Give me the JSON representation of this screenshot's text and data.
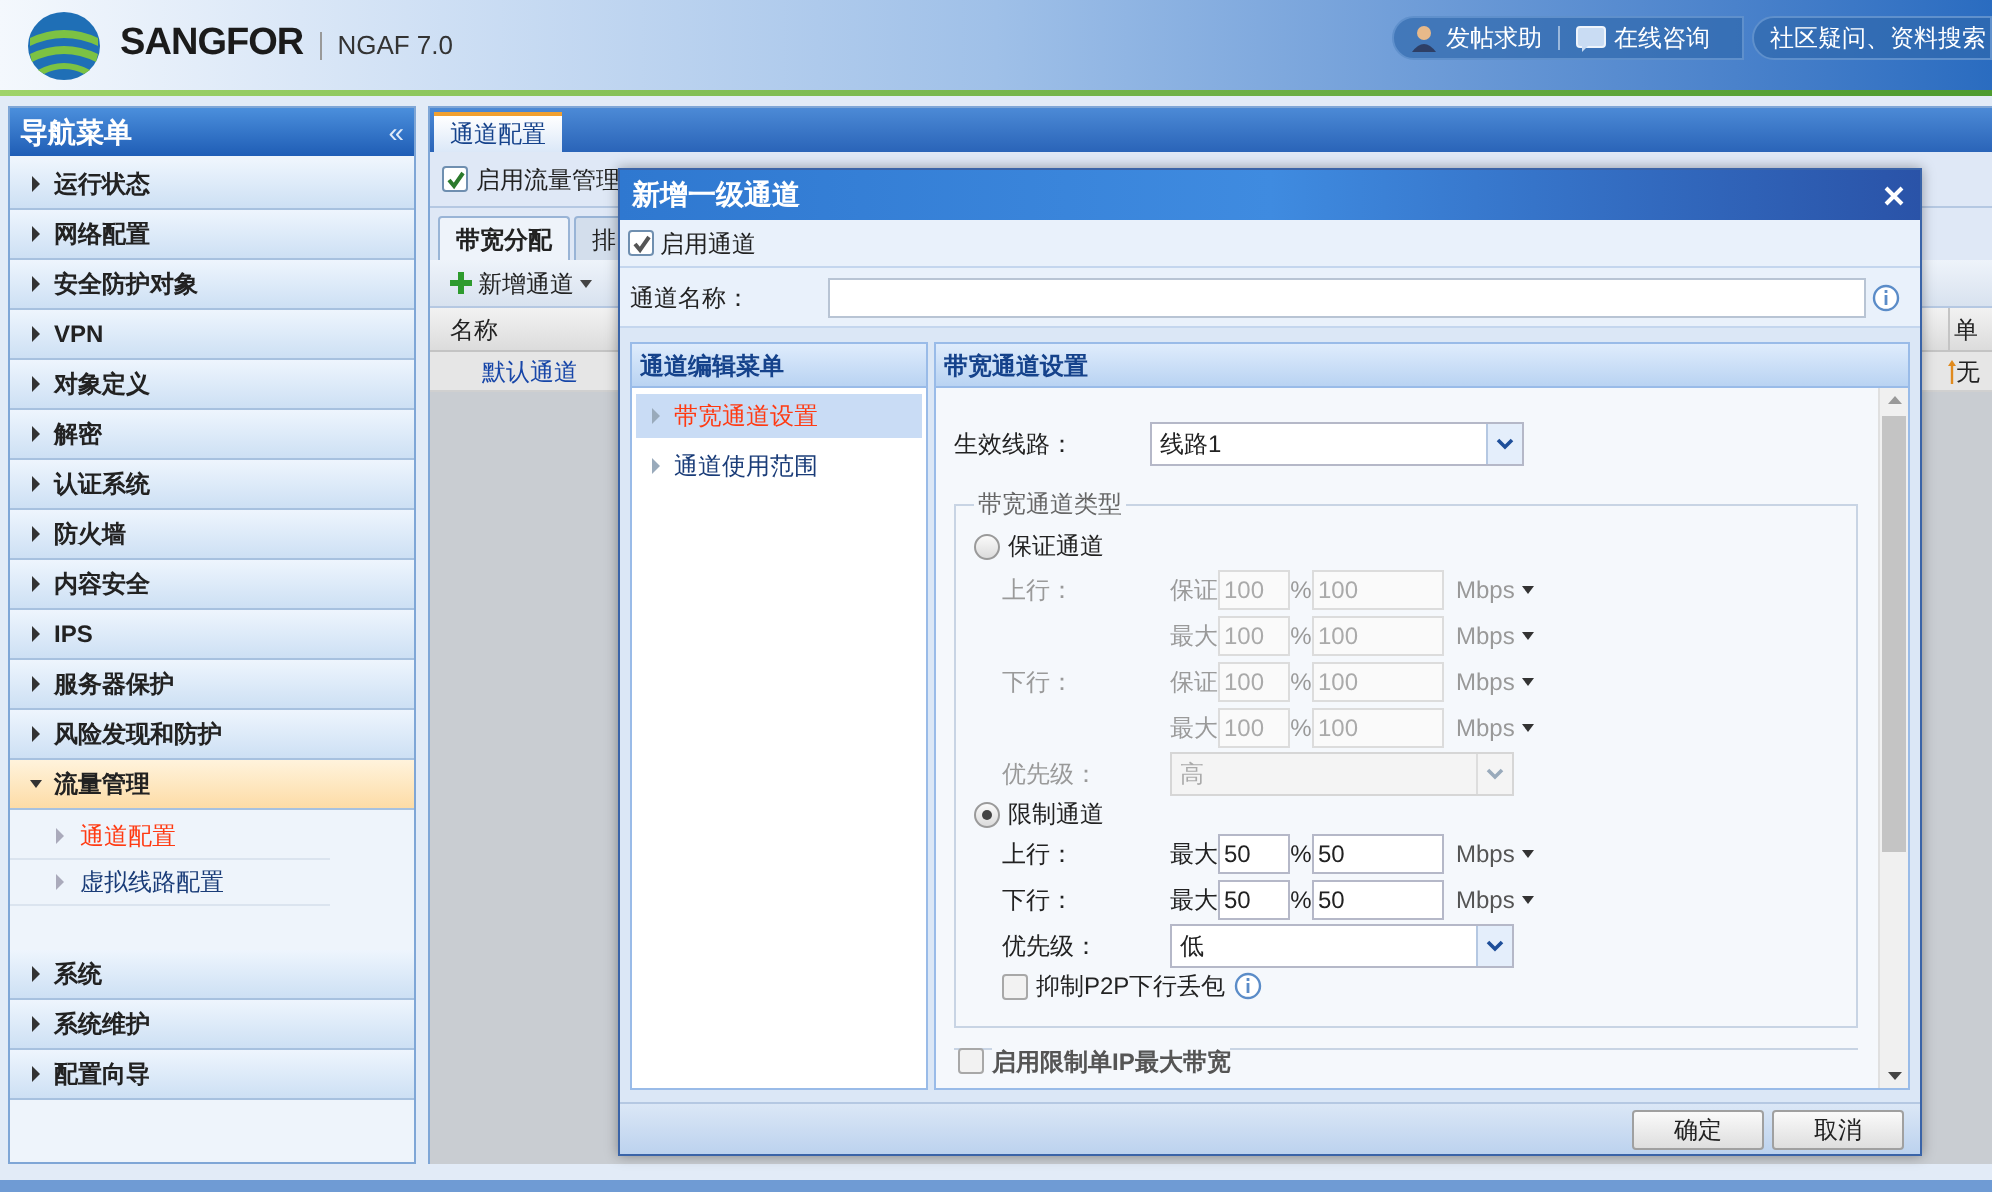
{
  "header": {
    "brand": "SANGFOR",
    "product": "NGAF 7.0",
    "links": [
      {
        "label": "发帖求助",
        "kind": "person"
      },
      {
        "label": "在线咨询",
        "kind": "chat"
      },
      {
        "label": "社区疑问、资料搜索",
        "kind": "plain"
      }
    ]
  },
  "sidebar": {
    "title": "导航菜单",
    "collapse": "«",
    "items": [
      {
        "label": "运行状态",
        "expanded": false
      },
      {
        "label": "网络配置",
        "expanded": false
      },
      {
        "label": "安全防护对象",
        "expanded": false
      },
      {
        "label": "VPN",
        "expanded": false
      },
      {
        "label": "对象定义",
        "expanded": false
      },
      {
        "label": "解密",
        "expanded": false
      },
      {
        "label": "认证系统",
        "expanded": false
      },
      {
        "label": "防火墙",
        "expanded": false
      },
      {
        "label": "内容安全",
        "expanded": false
      },
      {
        "label": "IPS",
        "expanded": false
      },
      {
        "label": "服务器保护",
        "expanded": false
      },
      {
        "label": "风险发现和防护",
        "expanded": false
      },
      {
        "label": "流量管理",
        "expanded": true,
        "children": [
          {
            "label": "通道配置",
            "selected": true
          },
          {
            "label": "虚拟线路配置",
            "selected": false
          }
        ]
      },
      {
        "label": "系统",
        "expanded": false
      },
      {
        "label": "系统维护",
        "expanded": false
      },
      {
        "label": "配置向导",
        "expanded": false
      }
    ]
  },
  "main": {
    "tabs": [
      {
        "label": "通道配置",
        "selected": true
      }
    ],
    "enable_traffic": {
      "label": "启用流量管理",
      "checked": true
    },
    "subtabs": [
      {
        "label": "带宽分配",
        "selected": true
      },
      {
        "label": "排",
        "selected": false
      }
    ],
    "toolbar": {
      "add_button": "新增通道"
    },
    "table": {
      "columns": [
        "名称",
        "单"
      ],
      "rows": [
        {
          "name": "默认通道",
          "column_2": "无"
        }
      ]
    }
  },
  "dialog": {
    "title": "新增一级通道",
    "enable": {
      "label": "启用通道",
      "checked": true
    },
    "name_field": {
      "label": "通道名称："
    },
    "menu": {
      "title": "通道编辑菜单",
      "items": [
        {
          "label": "带宽通道设置",
          "selected": true
        },
        {
          "label": "通道使用范围",
          "selected": false
        }
      ]
    },
    "settings": {
      "title": "带宽通道设置",
      "line": {
        "label": "生效线路：",
        "value": "线路1"
      },
      "group_title": "带宽通道类型",
      "options": [
        {
          "label": "保证通道",
          "selected": false,
          "rows": [
            {
              "direction": "上行：",
              "label": "保证",
              "percent": "100",
              "sign": "%",
              "value": "100",
              "unit": "Mbps"
            },
            {
              "label": "最大",
              "percent": "100",
              "sign": "%",
              "value": "100",
              "unit": "Mbps"
            },
            {
              "direction": "下行：",
              "label": "保证",
              "percent": "100",
              "sign": "%",
              "value": "100",
              "unit": "Mbps"
            },
            {
              "label": "最大",
              "percent": "100",
              "sign": "%",
              "value": "100",
              "unit": "Mbps"
            }
          ],
          "priority": {
            "label": "优先级：",
            "value": "高"
          }
        },
        {
          "label": "限制通道",
          "selected": true,
          "rows": [
            {
              "direction": "上行：",
              "label": "最大",
              "percent": "50",
              "sign": "%",
              "value": "50",
              "unit": "Mbps"
            },
            {
              "direction": "下行：",
              "label": "最大",
              "percent": "50",
              "sign": "%",
              "value": "50",
              "unit": "Mbps"
            }
          ],
          "priority": {
            "label": "优先级：",
            "value": "低"
          },
          "p2p": {
            "label": "抑制P2P下行丢包",
            "checked": false
          }
        }
      ],
      "ip_limit": {
        "label": "启用限制单IP最大带宽",
        "checked": false
      }
    },
    "buttons": [
      {
        "label": "确定"
      },
      {
        "label": "取消"
      }
    ]
  }
}
